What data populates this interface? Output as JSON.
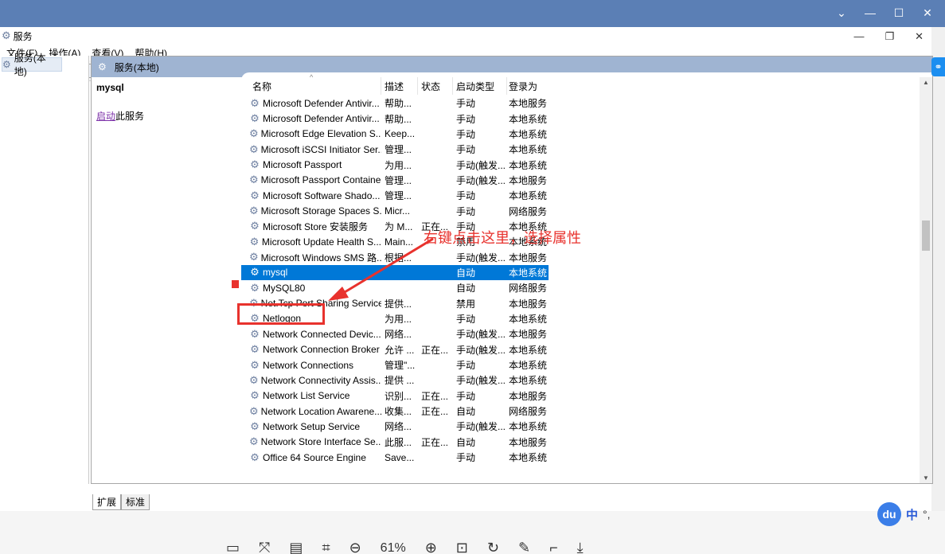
{
  "window": {
    "title": "服务"
  },
  "menu": [
    "文件(F)",
    "操作(A)",
    "查看(V)",
    "帮助(H)"
  ],
  "tree": {
    "root_label": "服务(本地)"
  },
  "panel": {
    "header_title": "服务(本地)",
    "selected_service": "mysql",
    "action_link": "启动",
    "action_suffix": "此服务"
  },
  "columns": {
    "name": "名称",
    "description": "描述",
    "status": "状态",
    "startup_type": "启动类型",
    "log_on_as": "登录为"
  },
  "services": [
    {
      "name": "Microsoft Defender Antivir...",
      "description": "帮助...",
      "status": "",
      "startup": "手动",
      "logon": "本地服务"
    },
    {
      "name": "Microsoft Defender Antivir...",
      "description": "帮助...",
      "status": "",
      "startup": "手动",
      "logon": "本地系统"
    },
    {
      "name": "Microsoft Edge Elevation S...",
      "description": "Keep...",
      "status": "",
      "startup": "手动",
      "logon": "本地系统"
    },
    {
      "name": "Microsoft iSCSI Initiator Ser...",
      "description": "管理...",
      "status": "",
      "startup": "手动",
      "logon": "本地系统"
    },
    {
      "name": "Microsoft Passport",
      "description": "为用...",
      "status": "",
      "startup": "手动(触发...",
      "logon": "本地系统"
    },
    {
      "name": "Microsoft Passport Container",
      "description": "管理...",
      "status": "",
      "startup": "手动(触发...",
      "logon": "本地服务"
    },
    {
      "name": "Microsoft Software Shado...",
      "description": "管理...",
      "status": "",
      "startup": "手动",
      "logon": "本地系统"
    },
    {
      "name": "Microsoft Storage Spaces S...",
      "description": "Micr...",
      "status": "",
      "startup": "手动",
      "logon": "网络服务"
    },
    {
      "name": "Microsoft Store 安装服务",
      "description": "为 M...",
      "status": "正在...",
      "startup": "手动",
      "logon": "本地系统"
    },
    {
      "name": "Microsoft Update Health S...",
      "description": "Main...",
      "status": "",
      "startup": "禁用",
      "logon": "本地系统"
    },
    {
      "name": "Microsoft Windows SMS 路...",
      "description": "根据...",
      "status": "",
      "startup": "手动(触发...",
      "logon": "本地服务"
    },
    {
      "name": "mysql",
      "description": "",
      "status": "",
      "startup": "自动",
      "logon": "本地系统",
      "selected": true
    },
    {
      "name": "MySQL80",
      "description": "",
      "status": "",
      "startup": "自动",
      "logon": "网络服务"
    },
    {
      "name": "Net.Tcp Port Sharing Service",
      "description": "提供...",
      "status": "",
      "startup": "禁用",
      "logon": "本地服务"
    },
    {
      "name": "Netlogon",
      "description": "为用...",
      "status": "",
      "startup": "手动",
      "logon": "本地系统"
    },
    {
      "name": "Network Connected Devic...",
      "description": "网络...",
      "status": "",
      "startup": "手动(触发...",
      "logon": "本地服务"
    },
    {
      "name": "Network Connection Broker",
      "description": "允许 ...",
      "status": "正在...",
      "startup": "手动(触发...",
      "logon": "本地系统"
    },
    {
      "name": "Network Connections",
      "description": "管理\"...",
      "status": "",
      "startup": "手动",
      "logon": "本地系统"
    },
    {
      "name": "Network Connectivity Assis...",
      "description": "提供 ...",
      "status": "",
      "startup": "手动(触发...",
      "logon": "本地系统"
    },
    {
      "name": "Network List Service",
      "description": "识别...",
      "status": "正在...",
      "startup": "手动",
      "logon": "本地服务"
    },
    {
      "name": "Network Location Awarene...",
      "description": "收集...",
      "status": "正在...",
      "startup": "自动",
      "logon": "网络服务"
    },
    {
      "name": "Network Setup Service",
      "description": "网络...",
      "status": "",
      "startup": "手动(触发...",
      "logon": "本地系统"
    },
    {
      "name": "Network Store Interface Se...",
      "description": "此服...",
      "status": "正在...",
      "startup": "自动",
      "logon": "本地服务"
    },
    {
      "name": "Office 64 Source Engine",
      "description": "Save...",
      "status": "",
      "startup": "手动",
      "logon": "本地系统"
    }
  ],
  "tabs": [
    "扩展",
    "标准"
  ],
  "annotation": {
    "text": "右键点击这里，选择属性",
    "color": "#e8322d"
  },
  "viewer": {
    "zoom": "61%"
  },
  "ime": {
    "logo": "du",
    "mode": "中",
    "punct": "°,"
  }
}
